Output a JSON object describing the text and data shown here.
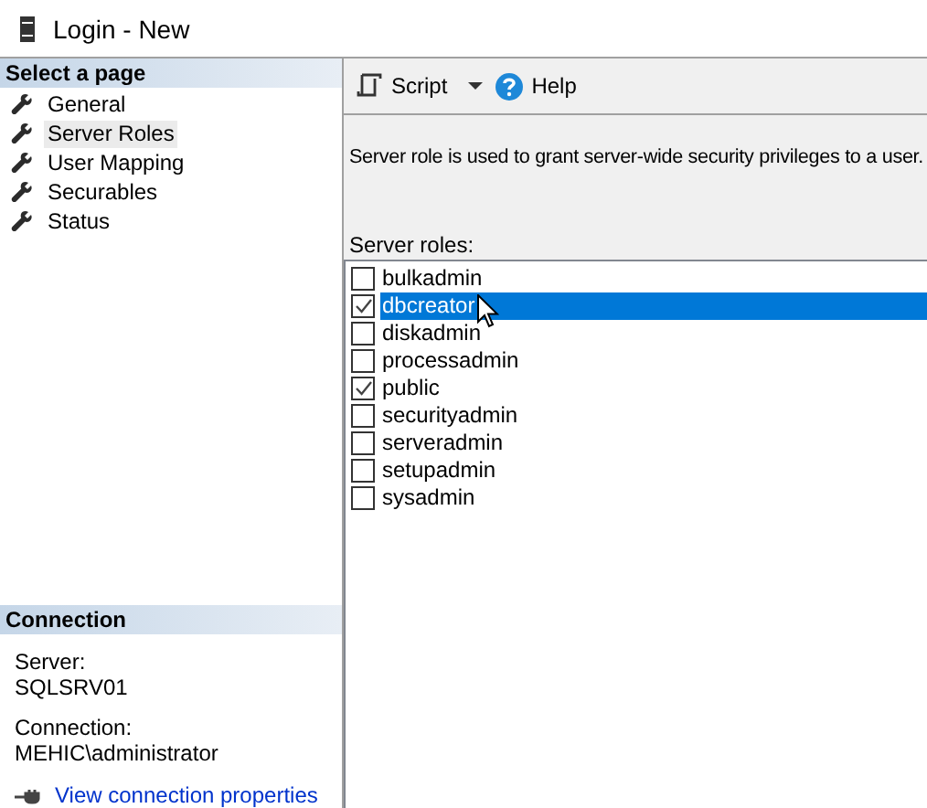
{
  "window": {
    "title": "Login - New"
  },
  "sidebar": {
    "header": "Select a page",
    "items": [
      {
        "label": "General",
        "selected": false
      },
      {
        "label": "Server Roles",
        "selected": true
      },
      {
        "label": "User Mapping",
        "selected": false
      },
      {
        "label": "Securables",
        "selected": false
      },
      {
        "label": "Status",
        "selected": false
      }
    ]
  },
  "connection": {
    "header": "Connection",
    "server_label": "Server:",
    "server": "SQLSRV01",
    "connection_label": "Connection:",
    "connection": "MEHIC\\administrator",
    "link": "View connection properties"
  },
  "toolbar": {
    "script": "Script",
    "help": "Help"
  },
  "description": "Server role is used to grant server-wide security privileges to a user.",
  "roles_label": "Server roles:",
  "roles": [
    {
      "name": "bulkadmin",
      "checked": false,
      "selected": false
    },
    {
      "name": "dbcreator",
      "checked": true,
      "selected": true
    },
    {
      "name": "diskadmin",
      "checked": false,
      "selected": false
    },
    {
      "name": "processadmin",
      "checked": false,
      "selected": false
    },
    {
      "name": "public",
      "checked": true,
      "selected": false
    },
    {
      "name": "securityadmin",
      "checked": false,
      "selected": false
    },
    {
      "name": "serveradmin",
      "checked": false,
      "selected": false
    },
    {
      "name": "setupadmin",
      "checked": false,
      "selected": false
    },
    {
      "name": "sysadmin",
      "checked": false,
      "selected": false
    }
  ]
}
